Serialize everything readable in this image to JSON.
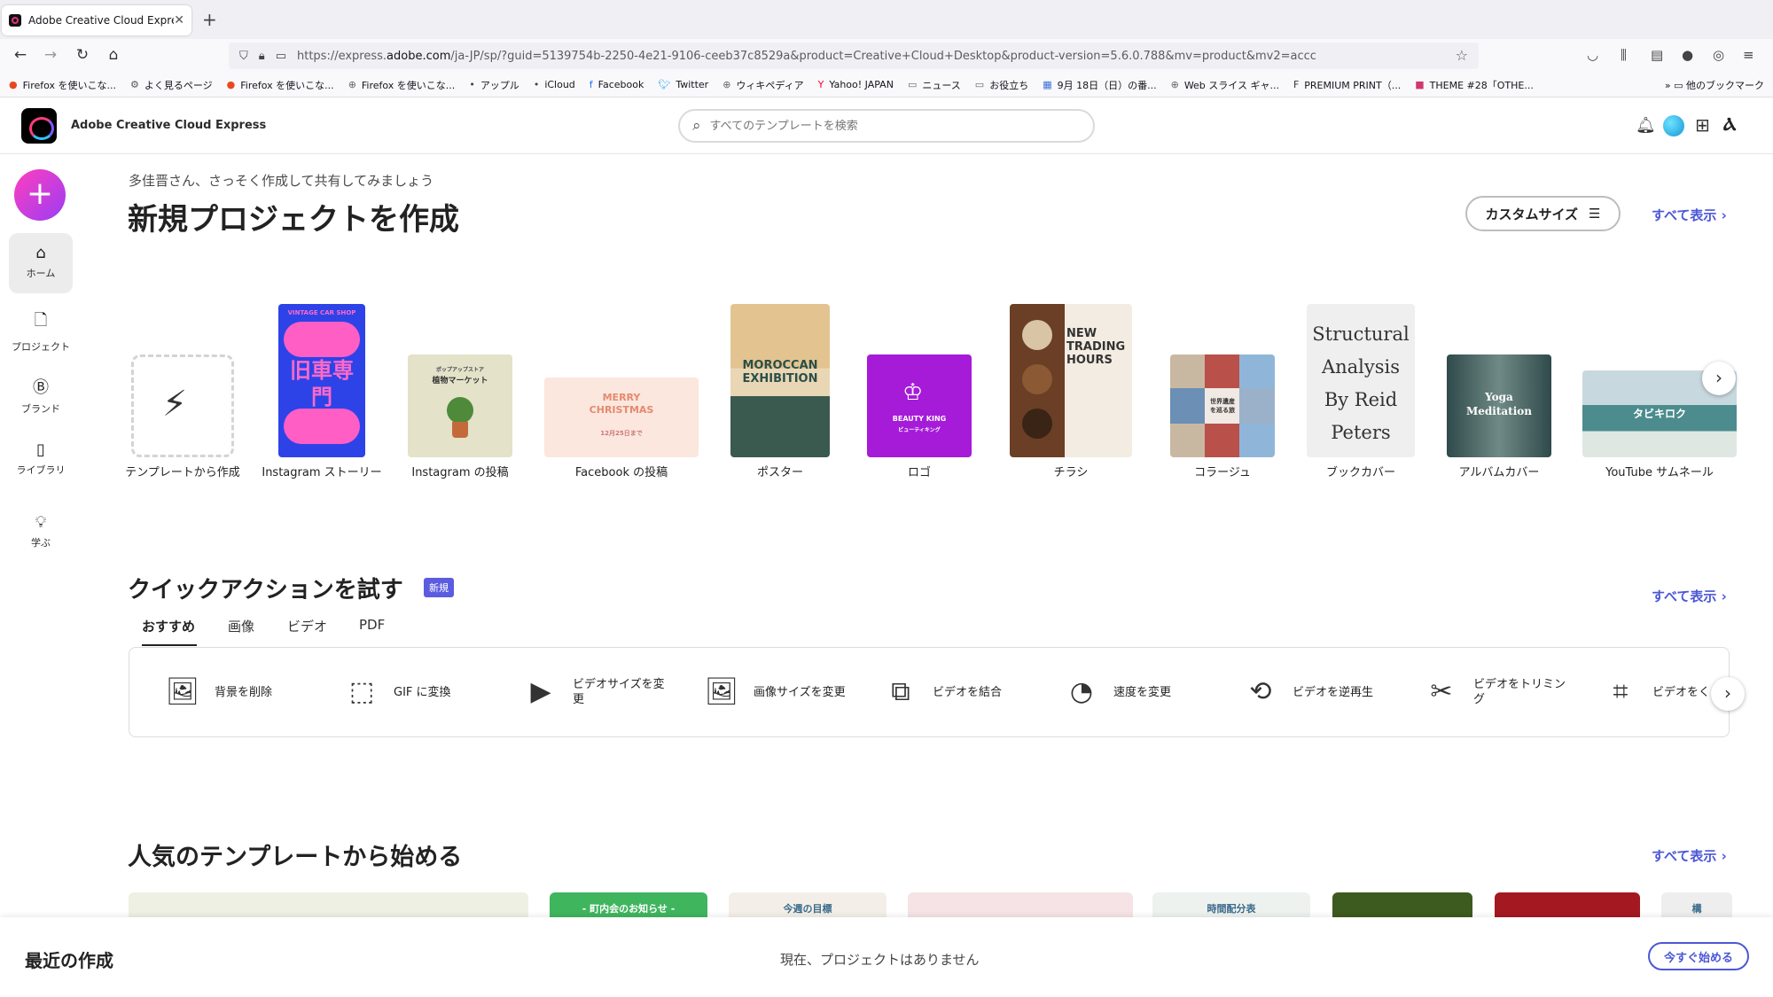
{
  "browser": {
    "tab_title": "Adobe Creative Cloud Express",
    "url_prefix": "https://express.",
    "url_domain": "adobe.com",
    "url_rest": "/ja-JP/sp/?guid=5139754b-2250-4e21-9106-ceeb37c8529a&product=Creative+Cloud+Desktop&product-version=5.6.0.788&mv=product&mv2=accc",
    "bookmarks": [
      {
        "label": "Firefox を使いこな...",
        "icon": "firefox-icon",
        "color": "#e8481f"
      },
      {
        "label": "よく見るページ",
        "icon": "gear-icon",
        "color": "#555555"
      },
      {
        "label": "Firefox を使いこな...",
        "icon": "firefox-icon",
        "color": "#e8481f"
      },
      {
        "label": "Firefox を使いこな...",
        "icon": "globe-icon",
        "color": "#666666"
      },
      {
        "label": "アップル",
        "icon": "apple-icon",
        "color": "#444444"
      },
      {
        "label": "iCloud",
        "icon": "apple-icon",
        "color": "#444444"
      },
      {
        "label": "Facebook",
        "icon": "facebook-icon",
        "color": "#1877f2"
      },
      {
        "label": "Twitter",
        "icon": "twitter-icon",
        "color": "#1da1f2"
      },
      {
        "label": "ウィキペディア",
        "icon": "globe-icon",
        "color": "#666666"
      },
      {
        "label": "Yahoo! JAPAN",
        "icon": "yahoo-icon",
        "color": "#ff0033"
      },
      {
        "label": "ニュース",
        "icon": "folder-icon",
        "color": "#666666"
      },
      {
        "label": "お役立ち",
        "icon": "folder-icon",
        "color": "#666666"
      },
      {
        "label": "9月 18日（日）の番...",
        "icon": "calendar-icon",
        "color": "#3a6fd8"
      },
      {
        "label": "Web スライス ギャ...",
        "icon": "globe-icon",
        "color": "#666666"
      },
      {
        "label": "PREMIUM PRINT（...",
        "icon": "premium-icon",
        "color": "#333333"
      },
      {
        "label": "THEME #28「OTHE...",
        "icon": "theme-icon",
        "color": "#d2386b"
      }
    ],
    "other_bookmarks": "他のブックマーク"
  },
  "header": {
    "app_name": "Adobe Creative Cloud Express",
    "search_placeholder": "すべてのテンプレートを検索"
  },
  "rail": {
    "items": [
      {
        "label": "ホーム",
        "icon": "home-icon"
      },
      {
        "label": "プロジェクト",
        "icon": "file-icon"
      },
      {
        "label": "ブランド",
        "icon": "brand-icon"
      },
      {
        "label": "ライブラリ",
        "icon": "library-icon"
      },
      {
        "label": "学ぶ",
        "icon": "lightbulb-icon"
      }
    ]
  },
  "main": {
    "greeting": "多佳晋さん、さっそく作成して共有してみましょう",
    "title": "新規プロジェクトを作成",
    "custom_size": "カスタムサイズ",
    "see_all": "すべて表示",
    "templates": [
      {
        "label": "テンプレートから作成"
      },
      {
        "label": "Instagram ストーリー",
        "thumb_text": "旧車専門",
        "thumb_sub": "VINTAGE CAR SHOP"
      },
      {
        "label": "Instagram の投稿",
        "thumb_text": "植物マーケット",
        "thumb_sub": "ポップアップストア"
      },
      {
        "label": "Facebook の投稿",
        "thumb_text": "MERRY CHRISTMAS",
        "thumb_sub": "12月25日まで"
      },
      {
        "label": "ポスター",
        "thumb_text": "MOROCCAN EXHIBITION"
      },
      {
        "label": "ロゴ",
        "thumb_text": "BEAUTY KING",
        "thumb_sub": "ビューティキング"
      },
      {
        "label": "チラシ",
        "thumb_text": "NEW TRADING HOURS"
      },
      {
        "label": "コラージュ",
        "thumb_text": "世界遺産を巡る旅"
      },
      {
        "label": "ブックカバー",
        "thumb_text": "Structural Analysis By Reid Peters"
      },
      {
        "label": "アルバムカバー",
        "thumb_text": "Yoga Meditation"
      },
      {
        "label": "YouTube サムネール",
        "thumb_text": "タビキロク"
      }
    ]
  },
  "quick_actions": {
    "title": "クイックアクションを試す",
    "badge": "新規",
    "see_all": "すべて表示",
    "tabs": [
      "おすすめ",
      "画像",
      "ビデオ",
      "PDF"
    ],
    "items": [
      {
        "label": "背景を削除",
        "icon": "image-remove-bg-icon"
      },
      {
        "label": "GIF に変換",
        "icon": "gif-convert-icon"
      },
      {
        "label": "ビデオサイズを変更",
        "icon": "video-resize-icon"
      },
      {
        "label": "画像サイズを変更",
        "icon": "image-resize-icon"
      },
      {
        "label": "ビデオを結合",
        "icon": "video-merge-icon"
      },
      {
        "label": "速度を変更",
        "icon": "speed-icon"
      },
      {
        "label": "ビデオを逆再生",
        "icon": "video-reverse-icon"
      },
      {
        "label": "ビデオをトリミング",
        "icon": "video-trim-icon"
      },
      {
        "label": "ビデオをく",
        "icon": "video-crop-icon"
      }
    ]
  },
  "popular": {
    "title": "人気のテンプレートから始める",
    "see_all": "すべて表示",
    "cards": [
      {
        "text": "",
        "color": "#eef0e4"
      },
      {
        "text": "- 町内会のお知らせ -",
        "color": "#3fb55e"
      },
      {
        "text": "今週の目標",
        "color": "#f3efe8"
      },
      {
        "text": "",
        "color": "#f5e3e6"
      },
      {
        "text": "時間配分表",
        "color": "#eef2ee"
      },
      {
        "text": "",
        "color": "#3d5a1f"
      },
      {
        "text": "",
        "color": "#a41821"
      },
      {
        "text": "構",
        "color": "#eeeeee"
      }
    ]
  },
  "recent": {
    "title": "最近の作成",
    "empty": "現在、プロジェクトはありません",
    "start_now": "今すぐ始める"
  },
  "colors": {
    "accent": "#4b57d6",
    "create_gradient_start": "#ff3fbe",
    "create_gradient_end": "#9b3cf5"
  }
}
